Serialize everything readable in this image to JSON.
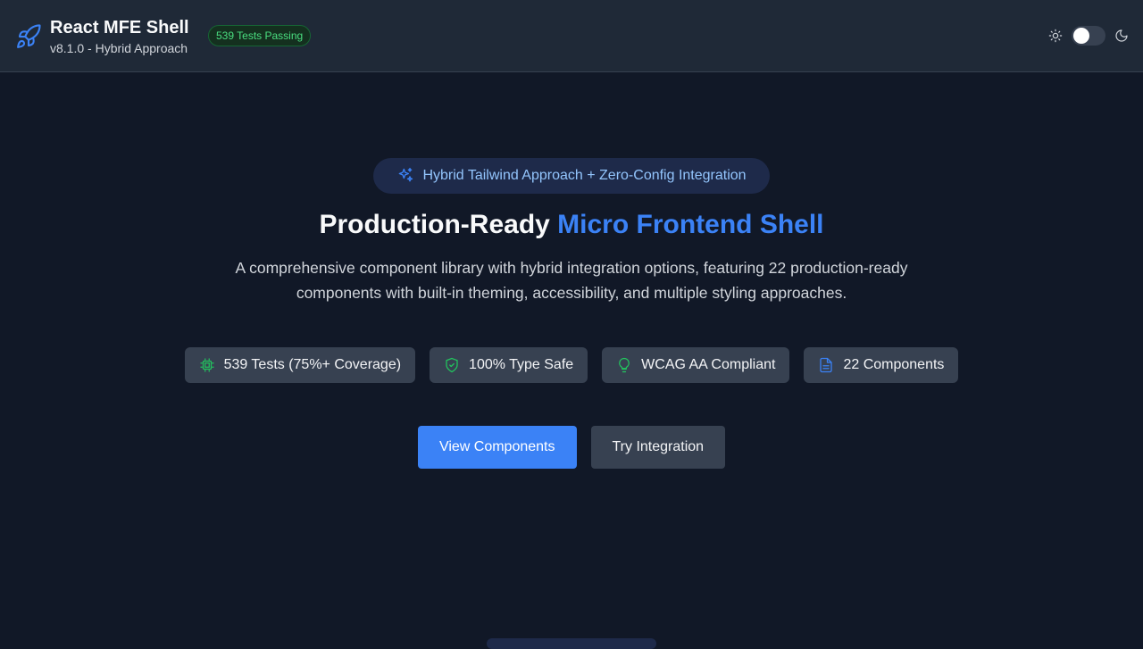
{
  "header": {
    "title": "React MFE Shell",
    "subtitle": "v8.1.0 - Hybrid Approach",
    "status_badge": "539 Tests Passing",
    "icons": {
      "logo": "rocket-icon",
      "light": "sun-icon",
      "dark": "moon-icon"
    },
    "theme_toggle": {
      "mode": "light"
    }
  },
  "hero": {
    "badge": "Hybrid Tailwind Approach + Zero-Config Integration",
    "title_plain": "Production-Ready ",
    "title_accent": "Micro Frontend Shell",
    "description": "A comprehensive component library with hybrid integration options, featuring 22 production-ready components with built-in theming, accessibility, and multiple styling approaches."
  },
  "features": [
    {
      "label": "539 Tests (75%+ Coverage)",
      "icon": "chip-icon",
      "color": "#22c55e"
    },
    {
      "label": "100% Type Safe",
      "icon": "shield-check-icon",
      "color": "#22c55e"
    },
    {
      "label": "WCAG AA Compliant",
      "icon": "lightbulb-icon",
      "color": "#22c55e"
    },
    {
      "label": "22 Components",
      "icon": "document-icon",
      "color": "#3b82f6"
    }
  ],
  "actions": {
    "primary": "View Components",
    "secondary": "Try Integration"
  },
  "colors": {
    "background": "#111827",
    "header": "#1f2937",
    "accent": "#3b82f6",
    "success": "#4ade80"
  }
}
